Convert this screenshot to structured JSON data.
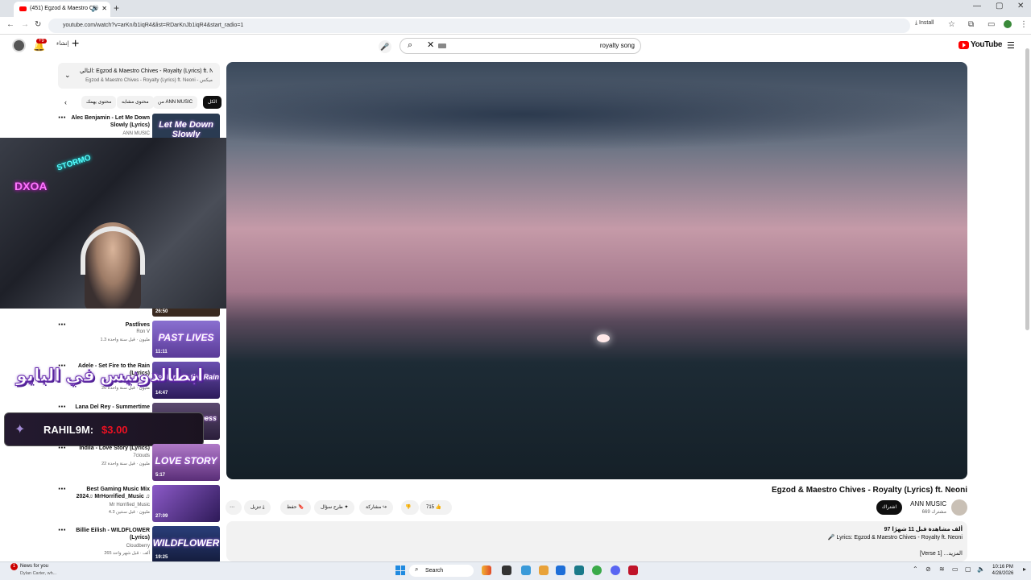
{
  "browser": {
    "tab_title": "(451) Egzod & Maestro Chi",
    "url": "youtube.com/watch?v=arKn/b1iqR4&list=RDarKnJb1iqR4&start_radio=1",
    "install_label": "Install"
  },
  "header": {
    "notif_count": "+9",
    "create_label": "إنشاء",
    "search_value": "royalty song",
    "logo_text": "YouTube"
  },
  "playlist": {
    "title": "التالي: Egzod & Maestro Chives - Royalty (Lyrics) ft. N...",
    "subtitle": "Egzod & Maestro Chives - Royalty (Lyrics) ft. Neoni - ميكس"
  },
  "chips": [
    "الكل",
    "من ANN MUSIC",
    "محتوى مشابه",
    "محتوى يهمك"
  ],
  "recommendations": [
    {
      "title": "Alec Benjamin - Let Me Down Slowly (Lyrics)",
      "channel": "ANN MUSIC",
      "meta": "",
      "thumb": "Let Me Down Slowly",
      "duration": "",
      "color": "#2a3b52"
    },
    {
      "title": "Pastlives",
      "channel": "Ron V",
      "meta": "1.3 مليون · قبل سنة واحدة",
      "thumb": "PAST LIVES",
      "duration": "11:11",
      "color": "#6a4aa8"
    },
    {
      "title": "Adele - Set Fire to the Rain (Lyrics)",
      "channel": "",
      "meta": "20 مليون · قبل سنة واحدة",
      "thumb": "Set Fire to the Rain",
      "duration": "14:47",
      "color": "#4b2c8a"
    },
    {
      "title": "Lana Del Rey - Summertime",
      "channel": "",
      "meta": "",
      "thumb": "Sadness",
      "duration": "",
      "color": "#3c2a50"
    },
    {
      "title": "Indila - Love Story (Lyrics)",
      "channel": "7clouds",
      "meta": "22 مليون · قبل سنة واحدة",
      "thumb": "LOVE STORY",
      "duration": "5:17",
      "color": "#7a4a9c"
    },
    {
      "title": "Best Gaming Music Mix 2024♫ MrHorrified_Music ♫",
      "channel": "Mr Horrified_Music",
      "meta": "4.3 مليون · قبل سنتين",
      "thumb": "",
      "duration": "27:09",
      "color": "#5a3a8a"
    },
    {
      "title": "Billie Eilish - WILDFLOWER (Lyrics)",
      "channel": "Cloudberry",
      "meta": "265 ألف · قبل شهر واحد",
      "thumb": "WILDFLOWER",
      "duration": "19:25",
      "color": "#1c2a5a"
    }
  ],
  "webcam_duration": "26:50",
  "overlay": {
    "arabic_text": "ابطالدونيس في البايو",
    "donor": "RAHIL9M:",
    "amount": "$3.00"
  },
  "video": {
    "title": "Egzod & Maestro Chives - Royalty (Lyrics) ft. Neoni",
    "channel": "ANN MUSIC",
    "subs": "669 مشترك",
    "subscribe_label": "اشتراك",
    "likes": "715",
    "share_label": "مشاركة",
    "ask_label": "طرح سؤال",
    "save_label": "حفظ",
    "download_label": "تنزيل"
  },
  "description": {
    "views": "97 ألف مشاهدة قبل 11 شهرًا",
    "lyrics": "🎤 Lyrics: Egzod & Maestro Chives - Royalty ft. Neoni",
    "more": "[Verse 1] ...المزيد"
  },
  "taskbar": {
    "news_title": "News for you",
    "news_sub": "Dylan Carter, wh...",
    "news_badge": "1",
    "search_label": "Search",
    "time": "10:16 PM",
    "date": "4/28/2026"
  }
}
